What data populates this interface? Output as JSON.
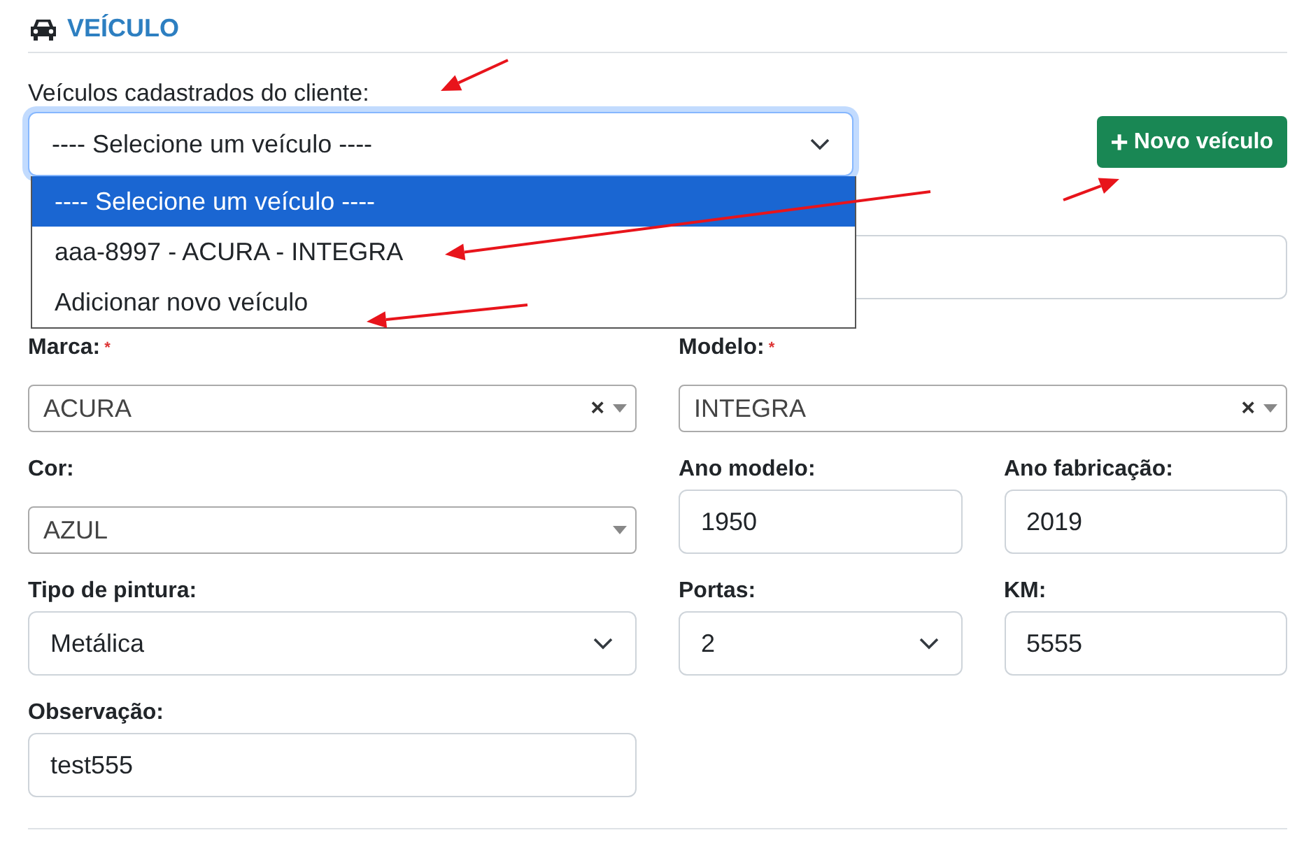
{
  "section": {
    "title": "VEÍCULO"
  },
  "vehicle_select": {
    "label": "Veículos cadastrados do cliente:",
    "value": "---- Selecione um veículo ----",
    "options": [
      {
        "text": "---- Selecione um veículo ----",
        "selected": true
      },
      {
        "text": "aaa-8997 - ACURA - INTEGRA",
        "selected": false
      },
      {
        "text": "Adicionar novo veículo",
        "selected": false
      }
    ]
  },
  "new_button": {
    "icon": "+",
    "label": "Novo veículo"
  },
  "rows": [
    {
      "fields": [
        {
          "kind": "input"
        }
      ]
    },
    {
      "fields": [
        {
          "label": "Marca:",
          "required_mark": "*",
          "kind": "select2",
          "value": "ACURA",
          "clear_icon": "×"
        },
        {
          "label": "Modelo:",
          "required_mark": "*",
          "kind": "select2",
          "value": "INTEGRA",
          "clear_icon": "×"
        }
      ]
    },
    {
      "fields": [
        {
          "label": "Cor:",
          "kind": "select2",
          "value": "AZUL"
        },
        {
          "label": "Ano modelo:",
          "kind": "input",
          "value": "1950"
        },
        {
          "label": "Ano fabricação:",
          "kind": "input",
          "value": "2019"
        }
      ]
    },
    {
      "fields": [
        {
          "label": "Tipo de pintura:",
          "kind": "select",
          "value": "Metálica"
        },
        {
          "label": "Portas:",
          "kind": "select",
          "value": "2"
        },
        {
          "label": "KM:",
          "kind": "input",
          "value": "5555"
        }
      ]
    },
    {
      "fields": [
        {
          "label": "Observação:",
          "kind": "input",
          "value": "test555"
        }
      ]
    }
  ]
}
